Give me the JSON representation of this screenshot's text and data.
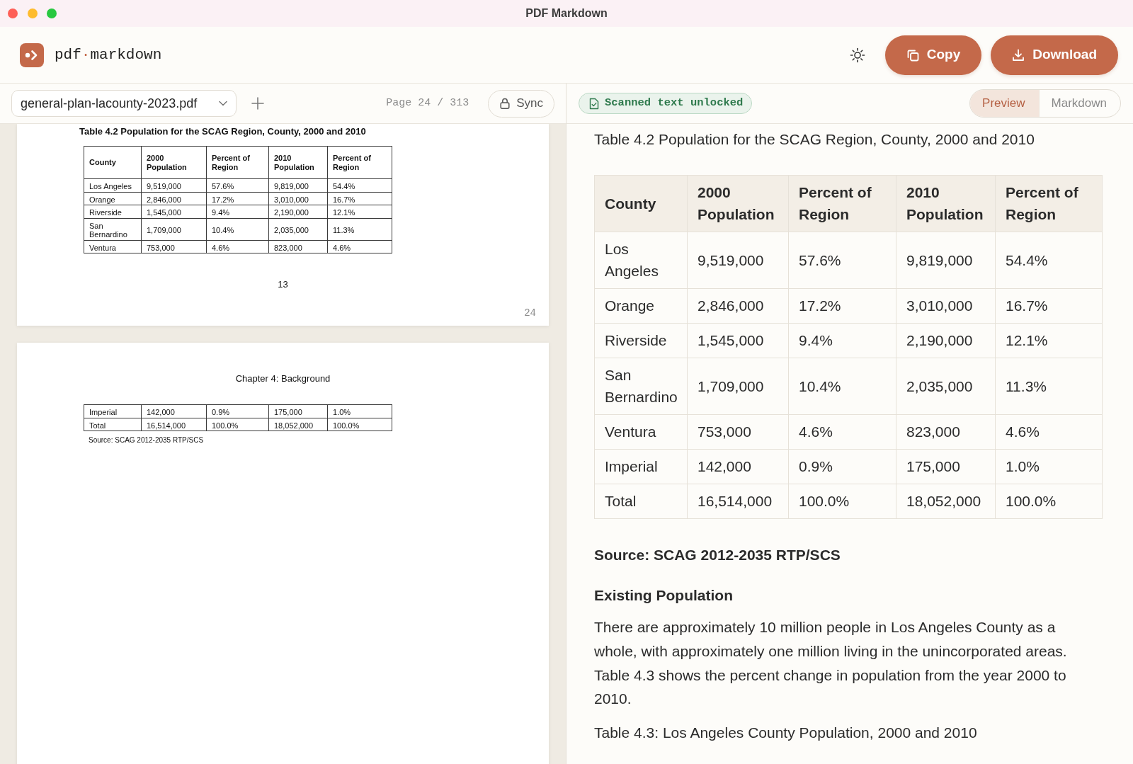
{
  "window": {
    "title": "PDF Markdown"
  },
  "header": {
    "brand": {
      "start": "pdf",
      "separator": "·",
      "end": "markdown"
    },
    "actions": [
      {
        "kind": "copy",
        "label": "Copy"
      },
      {
        "kind": "download",
        "label": "Download"
      }
    ]
  },
  "document_toolbar": {
    "file": "general-plan-lacounty-2023.pdf",
    "page_indicator": "Page 24 / 313",
    "sync_label": "Sync"
  },
  "pdf_pages": [
    {
      "page_number": "24",
      "blocks": [
        {
          "kind": "title",
          "text": "Table 4.2 Population for the SCAG Region, County, 2000 and 2010"
        },
        {
          "kind": "table",
          "header": [
            "County",
            "2000\nPopulation",
            "Percent of\nRegion",
            "2010\nPopulation",
            "Percent of\nRegion"
          ],
          "rows": [
            [
              "Los Angeles",
              "9,519,000",
              "57.6%",
              "9,819,000",
              "54.4%"
            ],
            [
              "Orange",
              "2,846,000",
              "17.2%",
              "3,010,000",
              "16.7%"
            ],
            [
              "Riverside",
              "1,545,000",
              "9.4%",
              "2,190,000",
              "12.1%"
            ],
            [
              "San\nBernardino",
              "1,709,000",
              "10.4%",
              "2,035,000",
              "11.3%"
            ],
            [
              "Ventura",
              "753,000",
              "4.6%",
              "823,000",
              "4.6%"
            ]
          ]
        },
        {
          "kind": "folio",
          "text": "13"
        }
      ]
    },
    {
      "blocks": [
        {
          "kind": "heading",
          "text": "Chapter 4: Background"
        },
        {
          "kind": "table",
          "rows": [
            [
              "Imperial",
              "142,000",
              "0.9%",
              "175,000",
              "1.0%"
            ],
            [
              "Total",
              "16,514,000",
              "100.0%",
              "18,052,000",
              "100.0%"
            ]
          ]
        },
        {
          "kind": "note",
          "text": "Source: SCAG 2012-2035 RTP/SCS"
        }
      ]
    }
  ],
  "preview_toolbar": {
    "badge": "Scanned text unlocked",
    "views": [
      {
        "label": "Preview",
        "selected": true
      },
      {
        "label": "Markdown",
        "selected": false
      }
    ]
  },
  "preview": {
    "blocks": [
      {
        "kind": "paragraph",
        "text": "Table 4.2 Population for the SCAG Region, County, 2000 and 2010"
      },
      {
        "kind": "table",
        "columns": [
          "County",
          "2000 Population",
          "Percent of Region",
          "2010 Population",
          "Percent of Region"
        ],
        "rows": [
          [
            "Los Angeles",
            "9,519,000",
            "57.6%",
            "9,819,000",
            "54.4%"
          ],
          [
            "Orange",
            "2,846,000",
            "17.2%",
            "3,010,000",
            "16.7%"
          ],
          [
            "Riverside",
            "1,545,000",
            "9.4%",
            "2,190,000",
            "12.1%"
          ],
          [
            "San Bernardino",
            "1,709,000",
            "10.4%",
            "2,035,000",
            "11.3%"
          ],
          [
            "Ventura",
            "753,000",
            "4.6%",
            "823,000",
            "4.6%"
          ],
          [
            "Imperial",
            "142,000",
            "0.9%",
            "175,000",
            "1.0%"
          ],
          [
            "Total",
            "16,514,000",
            "100.0%",
            "18,052,000",
            "100.0%"
          ]
        ]
      },
      {
        "kind": "strong",
        "text": "Source: SCAG 2012-2035 RTP/SCS"
      },
      {
        "kind": "heading",
        "text": "Existing Population"
      },
      {
        "kind": "paragraph",
        "text": "There are approximately 10 million people in Los Angeles County as a whole, with approximately one million living in the unincorporated areas. Table 4.3 shows the percent change in population from the year 2000 to 2010."
      },
      {
        "kind": "paragraph",
        "text": "Table 4.3: Los Angeles County Population, 2000 and 2010"
      }
    ]
  }
}
